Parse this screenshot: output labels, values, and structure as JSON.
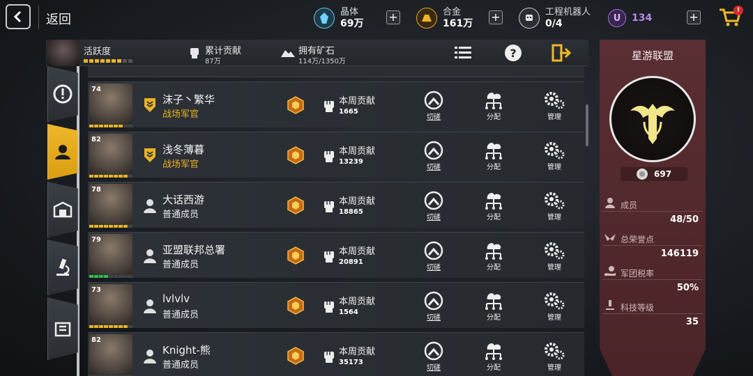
{
  "header": {
    "back_label": "返回",
    "resources": [
      {
        "name": "crystal",
        "label": "晶体",
        "value": "69万",
        "icon": "crystal-icon",
        "color": "#5fc8f0"
      },
      {
        "name": "alloy",
        "label": "合金",
        "value": "161万",
        "icon": "alloy-icon",
        "color": "#e9a524"
      },
      {
        "name": "robot",
        "label": "工程机器人",
        "value": "0/4",
        "icon": "robot-icon",
        "color": "#e8e8e8"
      },
      {
        "name": "u-currency",
        "label": "",
        "value": "134",
        "icon": "u-coin-icon",
        "color": "#a070d8"
      }
    ],
    "cart_badge": "!"
  },
  "stats": {
    "activity_label": "活跃度",
    "contribution_label": "累计贡献",
    "contribution_value": "87万",
    "ore_label": "拥有矿石",
    "ore_value": "114万/1350万"
  },
  "tabs": [
    {
      "icon": "alert-icon",
      "active": false
    },
    {
      "icon": "member-icon",
      "active": true
    },
    {
      "icon": "building-icon",
      "active": false
    },
    {
      "icon": "microscope-icon",
      "active": false
    },
    {
      "icon": "shop-icon",
      "active": false
    }
  ],
  "members": [
    {
      "level": "74",
      "name": "沫子丶繁华",
      "role": "战场军官",
      "officer": true,
      "weekly_label": "本周贡献",
      "weekly_value": "1665",
      "activity": 7,
      "activity_color": "#e9b324"
    },
    {
      "level": "82",
      "name": "浅冬薄暮",
      "role": "战场军官",
      "officer": true,
      "weekly_label": "本周贡献",
      "weekly_value": "13239",
      "activity": 8,
      "activity_color": "#e9b324"
    },
    {
      "level": "78",
      "name": "大话西游",
      "role": "普通成员",
      "officer": false,
      "weekly_label": "本周贡献",
      "weekly_value": "18865",
      "activity": 8,
      "activity_color": "#e9b324"
    },
    {
      "level": "79",
      "name": "亚盟联邦总署",
      "role": "普通成员",
      "officer": false,
      "weekly_label": "本周贡献",
      "weekly_value": "20891",
      "activity": 4,
      "activity_color": "#2fbf4a"
    },
    {
      "level": "73",
      "name": "lvlvlv",
      "role": "普通成员",
      "officer": false,
      "weekly_label": "本周贡献",
      "weekly_value": "1564",
      "activity": 8,
      "activity_color": "#e9b324"
    },
    {
      "level": "82",
      "name": "Knight-熊",
      "role": "普通成员",
      "officer": false,
      "weekly_label": "本周贡献",
      "weekly_value": "35173",
      "activity": 0,
      "activity_color": "#e9b324"
    }
  ],
  "actions": {
    "duel": "切磋",
    "assign": "分配",
    "manage": "管理"
  },
  "panel": {
    "alliance_name": "星游联盟",
    "coin_value": "697",
    "members_label": "成员",
    "members_value": "48/50",
    "honor_label": "总荣誉点",
    "honor_value": "146119",
    "tax_label": "军团税率",
    "tax_value": "50%",
    "tech_label": "科技等级",
    "tech_value": "35"
  }
}
